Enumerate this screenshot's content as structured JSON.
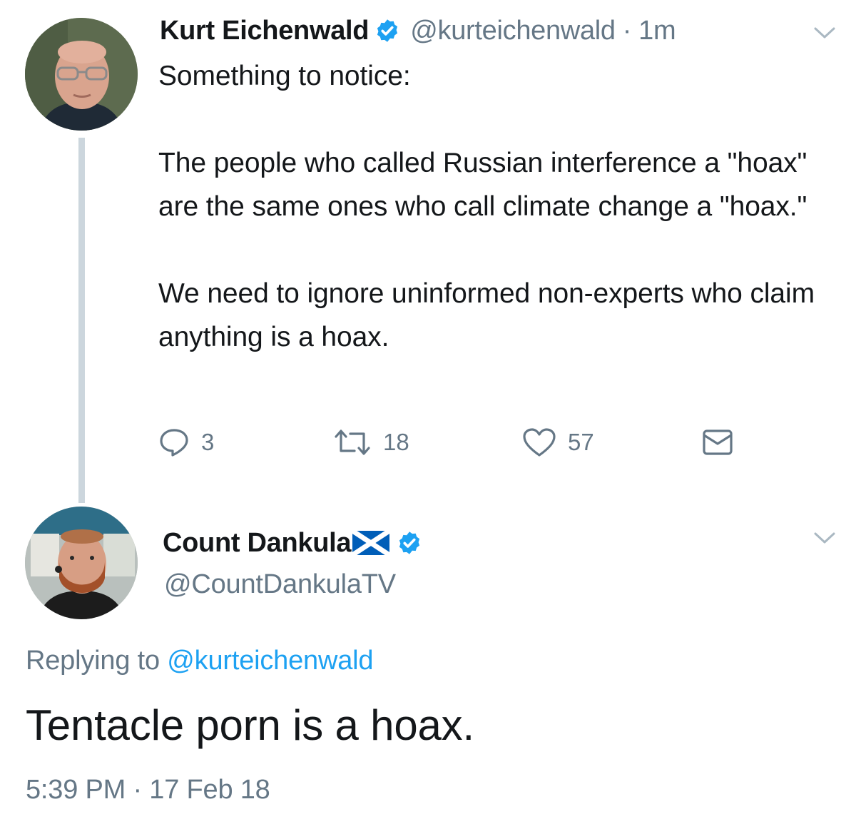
{
  "tweet": {
    "author_name": "Kurt Eichenwald",
    "author_handle": "@kurteichenwald",
    "separator": "·",
    "relative_time": "1m",
    "text": "Something to notice:\n\nThe people who called Russian interference a \"hoax\" are the same ones who call climate change a \"hoax.\"\n\nWe need to ignore uninformed non-experts who claim anything is a hoax.",
    "reply_count": "3",
    "retweet_count": "18",
    "like_count": "57",
    "icons": {
      "verified": "verified-badge-icon",
      "menu": "chevron-down-icon",
      "reply": "reply-bubble-icon",
      "retweet": "retweet-icon",
      "like": "heart-icon",
      "dm": "envelope-icon"
    }
  },
  "reply": {
    "author_name": "Count Dankula",
    "author_handle": "@CountDankulaTV",
    "flag_icon": "scotland-flag-icon",
    "replying_prefix": "Replying to",
    "replying_to": "@kurteichenwald",
    "text": "Tentacle porn is a hoax.",
    "timestamp": "5:39 PM · 17 Feb 18"
  },
  "colors": {
    "text": "#14171a",
    "secondary": "#657786",
    "link": "#1da1f2",
    "thread_line": "#ccd6dd",
    "verified": "#1da1f2"
  }
}
